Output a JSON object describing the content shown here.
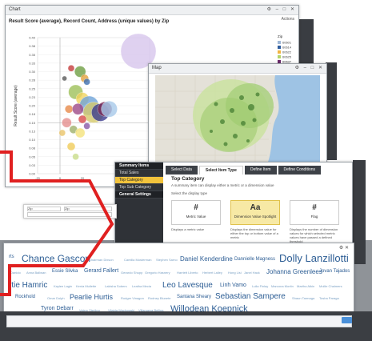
{
  "chart_window": {
    "title": "Chart",
    "subtitle": "Result Score (average), Record Count, Address (unique values) by Zip",
    "options_label": "Actions",
    "controls": "⚙ – □ ✕"
  },
  "chart_data": {
    "type": "scatter",
    "title": "Result Score (average), Record Count, Address (unique values) by Zip",
    "ylabel": "Result Score (average)",
    "xlabel": "",
    "xlim": [
      -20,
      80
    ],
    "ylim": [
      0,
      0.4
    ],
    "y_ticks": [
      "0.00",
      "0.03",
      "0.05",
      "0.08",
      "0.10",
      "0.13",
      "0.15",
      "0.18",
      "0.20",
      "0.23",
      "0.25",
      "0.28",
      "0.30",
      "0.33",
      "0.35",
      "0.38",
      "0.40"
    ],
    "x_ticks": [
      "-20",
      "0",
      "20"
    ],
    "legend_title": "Zip",
    "legend_items": [
      "60601",
      "60614",
      "60622",
      "60625",
      "60637",
      "60640",
      "60647"
    ],
    "legend_colors": [
      "#9fb7d6",
      "#2d5c9e",
      "#f2b441",
      "#b3d46a",
      "#6a2a6b",
      "#d9c2e8",
      "#e87a7a"
    ],
    "points": [
      {
        "x": 18,
        "y": 0.3,
        "r": 7,
        "c": "#6f9f44"
      },
      {
        "x": 10,
        "y": 0.31,
        "r": 4,
        "c": "#c43c3c"
      },
      {
        "x": 22,
        "y": 0.28,
        "r": 5,
        "c": "#e2a13f"
      },
      {
        "x": 4,
        "y": 0.28,
        "r": 3,
        "c": "#5a5a5a"
      },
      {
        "x": 24,
        "y": 0.27,
        "r": 4,
        "c": "#3d6fb0"
      },
      {
        "x": 14,
        "y": 0.24,
        "r": 9,
        "c": "#9fc05a"
      },
      {
        "x": 20,
        "y": 0.22,
        "r": 8,
        "c": "#f0d35e"
      },
      {
        "x": 26,
        "y": 0.2,
        "r": 12,
        "c": "#6fa4d8"
      },
      {
        "x": 30,
        "y": 0.18,
        "r": 13,
        "c": "#d4c96a"
      },
      {
        "x": 8,
        "y": 0.19,
        "r": 5,
        "c": "#e7894a"
      },
      {
        "x": 16,
        "y": 0.19,
        "r": 7,
        "c": "#9e4a87"
      },
      {
        "x": 36,
        "y": 0.18,
        "r": 11,
        "c": "#3c3c8e"
      },
      {
        "x": 40,
        "y": 0.19,
        "r": 9,
        "c": "#7b2a58"
      },
      {
        "x": 44,
        "y": 0.19,
        "r": 10,
        "c": "#a8c9ea"
      },
      {
        "x": 6,
        "y": 0.15,
        "r": 6,
        "c": "#e58e8e"
      },
      {
        "x": 12,
        "y": 0.13,
        "r": 5,
        "c": "#9fb06a"
      },
      {
        "x": 18,
        "y": 0.12,
        "r": 6,
        "c": "#f4e27c"
      },
      {
        "x": 2,
        "y": 0.12,
        "r": 4,
        "c": "#eac46a"
      },
      {
        "x": 10,
        "y": 0.08,
        "r": 5,
        "c": "#f0cc5a"
      },
      {
        "x": 14,
        "y": 0.05,
        "r": 4,
        "c": "#c9dc8a"
      },
      {
        "x": 20,
        "y": 0.16,
        "r": 5,
        "c": "#d84a4a"
      },
      {
        "x": 24,
        "y": 0.14,
        "r": 4,
        "c": "#8a5aa8"
      },
      {
        "x": 70,
        "y": 0.36,
        "r": 22,
        "c": "#d7c6ec"
      }
    ]
  },
  "map_window": {
    "title": "Map",
    "controls": "⚙ – □ ✕"
  },
  "category_window": {
    "tabs": [
      "Select Data",
      "Select Item Type",
      "Define Item",
      "Define Conditions"
    ],
    "active_tab": "Select Item Type",
    "sidebar": [
      "Summary Items",
      "Total Sales",
      "Top Category",
      "Top Sub Category",
      "General Settings"
    ],
    "heading": "Top Category",
    "description": "A summary item can display either a metric or a dimension value",
    "select_label": "Select the display type",
    "cards": [
      {
        "icon": "#",
        "label": "Metric Value",
        "desc": "Displays a metric value"
      },
      {
        "icon": "Aa",
        "label": "Dimension Value Spotlight",
        "desc": "Displays the dimension value for either the top or bottom value of a metric"
      },
      {
        "icon": "#",
        "label": "Flag",
        "desc": "Displays the number of dimension values for which selected metric values have passed a defined threshold"
      }
    ]
  },
  "toolbar_fragment": {
    "field1": "Zip",
    "field2": "Zip",
    "close": "✕"
  },
  "word_cloud": {
    "controls": "⚙ ✕",
    "words": [
      {
        "t": "rts",
        "s": 6,
        "x": 6,
        "y": 14,
        "c": "#2c5d94"
      },
      {
        "t": "Chance Gascon",
        "s": 12,
        "x": 22,
        "y": 12,
        "c": "#2c5d94"
      },
      {
        "t": "Chairman Dixson",
        "s": 4,
        "x": 106,
        "y": 18,
        "c": "#7aa0c4"
      },
      {
        "t": "Camilla Mosterman",
        "s": 4,
        "x": 150,
        "y": 18,
        "c": "#7aa0c4"
      },
      {
        "t": "Stephen Sarno",
        "s": 4,
        "x": 190,
        "y": 18,
        "c": "#7aa0c4"
      },
      {
        "t": "Daniel Kenderdine",
        "s": 8,
        "x": 220,
        "y": 15,
        "c": "#2c5d94"
      },
      {
        "t": "Dannielle Magness",
        "s": 6,
        "x": 288,
        "y": 17,
        "c": "#2c5d94"
      },
      {
        "t": "Dolly Lanzillotti",
        "s": 13,
        "x": 344,
        "y": 11,
        "c": "#2c5d94"
      },
      {
        "t": "Danicic",
        "s": 4,
        "x": 8,
        "y": 34,
        "c": "#7aa0c4"
      },
      {
        "t": "Anna Ballwan",
        "s": 4,
        "x": 28,
        "y": 34,
        "c": "#7aa0c4"
      },
      {
        "t": "Essie Slivka",
        "s": 6,
        "x": 60,
        "y": 32,
        "c": "#2c5d94"
      },
      {
        "t": "Gerard Fallert",
        "s": 7,
        "x": 100,
        "y": 31,
        "c": "#2c5d94"
      },
      {
        "t": "Gerardo Shupp",
        "s": 4,
        "x": 146,
        "y": 34,
        "c": "#7aa0c4"
      },
      {
        "t": "Gregorio Hasnery",
        "s": 4,
        "x": 176,
        "y": 34,
        "c": "#7aa0c4"
      },
      {
        "t": "Harriett Liberto",
        "s": 4,
        "x": 216,
        "y": 34,
        "c": "#7aa0c4"
      },
      {
        "t": "Herbert Lalley",
        "s": 4,
        "x": 248,
        "y": 34,
        "c": "#7aa0c4"
      },
      {
        "t": "Hong Lisi",
        "s": 4,
        "x": 280,
        "y": 34,
        "c": "#7aa0c4"
      },
      {
        "t": "Janel Hack",
        "s": 4,
        "x": 300,
        "y": 34,
        "c": "#7aa0c4"
      },
      {
        "t": "Johanna Greenlees",
        "s": 8,
        "x": 328,
        "y": 31,
        "c": "#2c5d94"
      },
      {
        "t": "Jovan Tajados",
        "s": 6,
        "x": 394,
        "y": 32,
        "c": "#2c5d94"
      },
      {
        "t": "rtie Hamric",
        "s": 10,
        "x": 6,
        "y": 47,
        "c": "#2c5d94"
      },
      {
        "t": "Kaylee Lagin",
        "s": 4,
        "x": 62,
        "y": 51,
        "c": "#7aa0c4"
      },
      {
        "t": "Kenia Mullette",
        "s": 4,
        "x": 90,
        "y": 51,
        "c": "#7aa0c4"
      },
      {
        "t": "Lakisha Sobers",
        "s": 4,
        "x": 126,
        "y": 51,
        "c": "#7aa0c4"
      },
      {
        "t": "Leatha Mecia",
        "s": 4,
        "x": 160,
        "y": 51,
        "c": "#7aa0c4"
      },
      {
        "t": "Leo Lavesque",
        "s": 10,
        "x": 198,
        "y": 47,
        "c": "#2c5d94"
      },
      {
        "t": "Linh Vamo",
        "s": 7,
        "x": 270,
        "y": 49,
        "c": "#2c5d94"
      },
      {
        "t": "Lulla Finlay",
        "s": 4,
        "x": 310,
        "y": 51,
        "c": "#7aa0c4"
      },
      {
        "t": "Marcona Mortin",
        "s": 4,
        "x": 334,
        "y": 51,
        "c": "#7aa0c4"
      },
      {
        "t": "Martha Atkin",
        "s": 4,
        "x": 366,
        "y": 51,
        "c": "#7aa0c4"
      },
      {
        "t": "Mollie Chalmers",
        "s": 4,
        "x": 394,
        "y": 51,
        "c": "#7aa0c4"
      },
      {
        "t": "Rockhold",
        "s": 6,
        "x": 14,
        "y": 64,
        "c": "#2c5d94"
      },
      {
        "t": "Omar Dolph",
        "s": 4,
        "x": 54,
        "y": 66,
        "c": "#7aa0c4"
      },
      {
        "t": "Pearlie Hurtis",
        "s": 9,
        "x": 82,
        "y": 62,
        "c": "#2c5d94"
      },
      {
        "t": "Rodger Vinagon",
        "s": 4,
        "x": 146,
        "y": 66,
        "c": "#7aa0c4"
      },
      {
        "t": "Rodney Blunete",
        "s": 4,
        "x": 180,
        "y": 66,
        "c": "#7aa0c4"
      },
      {
        "t": "Santana Sheary",
        "s": 6,
        "x": 216,
        "y": 64,
        "c": "#2c5d94"
      },
      {
        "t": "Sebastian Sampere",
        "s": 10,
        "x": 264,
        "y": 61,
        "c": "#2c5d94"
      },
      {
        "t": "Shaun Tarmaga",
        "s": 4,
        "x": 360,
        "y": 66,
        "c": "#7aa0c4"
      },
      {
        "t": "Tosha Paraga",
        "s": 4,
        "x": 394,
        "y": 66,
        "c": "#7aa0c4"
      },
      {
        "t": "Tyron Debarr",
        "s": 7,
        "x": 46,
        "y": 78,
        "c": "#2c5d94"
      },
      {
        "t": "Valery Sterling",
        "s": 4,
        "x": 94,
        "y": 81,
        "c": "#7aa0c4"
      },
      {
        "t": "Vilaida Wachowski",
        "s": 4,
        "x": 130,
        "y": 81,
        "c": "#7aa0c4"
      },
      {
        "t": "Villanueva Bellina",
        "s": 4,
        "x": 168,
        "y": 81,
        "c": "#7aa0c4"
      },
      {
        "t": "Willodean Koepnick",
        "s": 11,
        "x": 208,
        "y": 76,
        "c": "#2c5d94"
      }
    ]
  },
  "colors": {
    "accent_yellow": "#f2c33c",
    "dark_panel": "#2f3237",
    "arrow_red": "#e02020",
    "word_blue": "#2c5d94"
  }
}
